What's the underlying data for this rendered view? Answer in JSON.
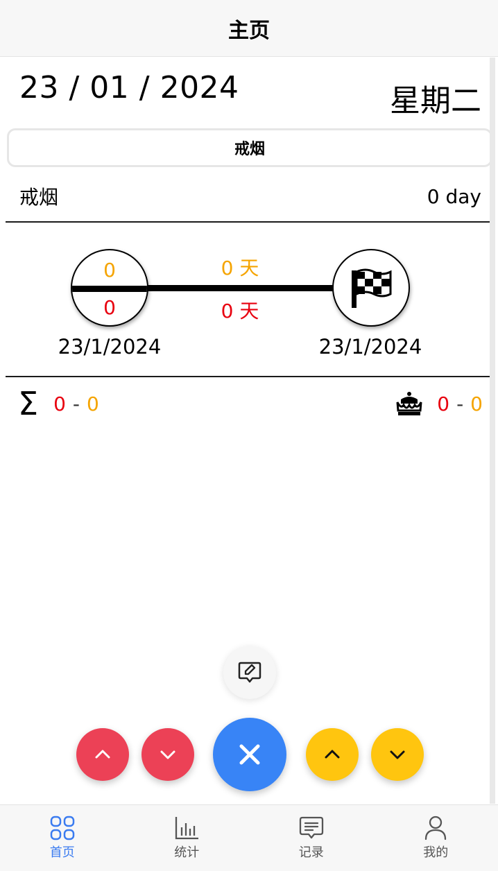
{
  "header": {
    "title": "主页"
  },
  "date": {
    "display": "23 / 01 / 2024",
    "weekday": "星期二"
  },
  "habit_tab": {
    "label": "戒烟"
  },
  "habit": {
    "name": "戒烟",
    "streak": "0 day"
  },
  "progress": {
    "start_top_count": "0",
    "start_bottom_count": "0",
    "days_top": "0 天",
    "days_bottom": "0 天",
    "start_date": "23/1/2024",
    "end_date": "23/1/2024"
  },
  "stats": {
    "total": {
      "red": "0",
      "sep": "-",
      "orange": "0"
    },
    "best": {
      "red": "0",
      "sep": "-",
      "orange": "0"
    }
  },
  "actions": {
    "note_icon": "edit-note-icon",
    "left_up": "chevron-up-icon",
    "left_down": "chevron-down-icon",
    "center": "close-icon",
    "right_up": "chevron-up-icon",
    "right_down": "chevron-down-icon"
  },
  "colors": {
    "red": "#e8000f",
    "orange": "#f5a400",
    "blue": "#3884f6",
    "red_button": "#ec4156",
    "yellow_button": "#ffc50f",
    "tab_active": "#3a7bf0"
  },
  "tabbar": {
    "items": [
      {
        "label": "首页",
        "icon": "grid-icon",
        "active": true
      },
      {
        "label": "统计",
        "icon": "bar-chart-icon",
        "active": false
      },
      {
        "label": "记录",
        "icon": "message-icon",
        "active": false
      },
      {
        "label": "我的",
        "icon": "user-icon",
        "active": false
      }
    ]
  }
}
